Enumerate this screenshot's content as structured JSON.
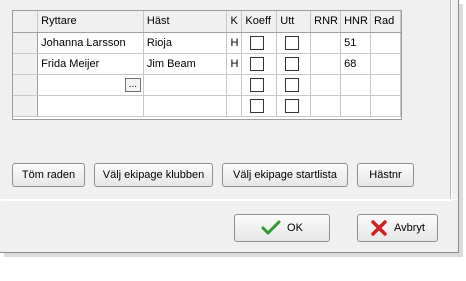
{
  "grid": {
    "columns": [
      "Ryttare",
      "Häst",
      "K",
      "Koeff",
      "Utt",
      "RNR",
      "HNR",
      "Rad"
    ],
    "rows": [
      {
        "ryttare": "Johanna Larsson",
        "hast": "Rioja",
        "k": "H",
        "koeff": false,
        "utt": false,
        "rnr": "",
        "hnr": "51",
        "rad": ""
      },
      {
        "ryttare": "Frida Meijer",
        "hast": "Jim Beam",
        "k": "H",
        "koeff": false,
        "utt": false,
        "rnr": "",
        "hnr": "68",
        "rad": ""
      },
      {
        "ryttare": "",
        "hast": "",
        "k": "",
        "koeff": false,
        "utt": false,
        "rnr": "",
        "hnr": "",
        "rad": ""
      },
      {
        "ryttare": "",
        "hast": "",
        "k": "",
        "koeff": false,
        "utt": false,
        "rnr": "",
        "hnr": "",
        "rad": ""
      }
    ],
    "ellipsis_label": "..."
  },
  "buttons": {
    "tom_raden": "Töm raden",
    "valj_klubben": "Välj ekipage klubben",
    "valj_startlista": "Välj ekipage startlista",
    "hastnr": "Hästnr",
    "ok": "OK",
    "avbryt": "Avbryt"
  },
  "colors": {
    "ok_icon": "#2e9b2e",
    "cancel_icon": "#d42020"
  }
}
